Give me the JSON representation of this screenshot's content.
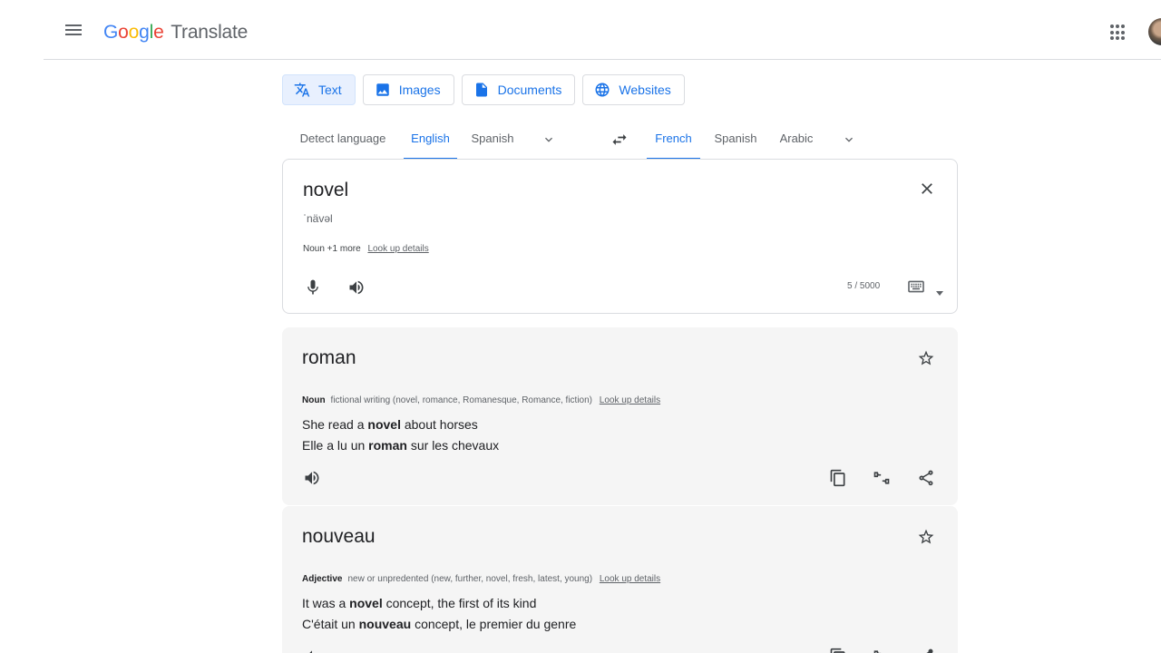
{
  "header": {
    "logo_letters": [
      "G",
      "o",
      "o",
      "g",
      "l",
      "e"
    ],
    "product": "Translate",
    "icons": [
      "menu-icon",
      "apps-icon",
      "avatar"
    ]
  },
  "modes": [
    {
      "label": "Text",
      "icon": "translate-icon",
      "active": true
    },
    {
      "label": "Images",
      "icon": "image-icon",
      "active": false
    },
    {
      "label": "Documents",
      "icon": "document-icon",
      "active": false
    },
    {
      "label": "Websites",
      "icon": "globe-icon",
      "active": false
    }
  ],
  "source_langs": {
    "detect": "Detect language",
    "items": [
      "English",
      "Spanish"
    ],
    "selected": "English"
  },
  "target_langs": {
    "items": [
      "French",
      "Spanish",
      "Arabic"
    ],
    "selected": "French"
  },
  "source": {
    "text": "novel",
    "phonetic": "ˈnävəl",
    "pos_summary": "Noun +1 more",
    "lookup": "Look up details",
    "char_count": "5 / 5000"
  },
  "translations": [
    {
      "word": "roman",
      "pos": "Noun",
      "definition": "fictional writing (novel, romance, Romanesque, Romance, fiction)",
      "lookup": "Look up details",
      "example_src": {
        "before": "She read a ",
        "bold": "novel",
        "after": " about horses"
      },
      "example_tgt": {
        "before": "Elle a lu un ",
        "bold": "roman",
        "after": " sur les chevaux"
      }
    },
    {
      "word": "nouveau",
      "pos": "Adjective",
      "definition": "new or unpredented (new, further, novel, fresh, latest, young)",
      "lookup": "Look up details",
      "example_src": {
        "before": "It was a ",
        "bold": "novel",
        "after": " concept, the first of its kind"
      },
      "example_tgt": {
        "before": "C'était un ",
        "bold": "nouveau",
        "after": " concept, le premier du genre"
      }
    }
  ],
  "colors": {
    "accent": "#1a73e8",
    "card_bg": "#f5f5f5",
    "divider": "#dadce0"
  }
}
